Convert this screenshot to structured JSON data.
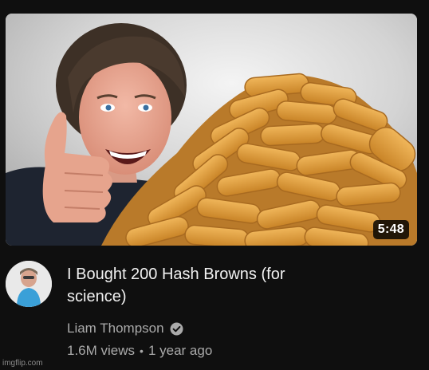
{
  "video": {
    "title": "I Bought 200 Hash Browns (for science)",
    "duration": "5:48",
    "channel_name": "Liam Thompson",
    "views": "1.6M views",
    "separator": "•",
    "published": "1 year ago"
  },
  "icons": {
    "verified": "verified-check-icon"
  },
  "watermark": "imgflip.com",
  "colors": {
    "background": "#0f0f0f",
    "title_text": "#f1f1f1",
    "secondary_text": "#aaaaaa",
    "hash_brown": "#d99a3a"
  }
}
